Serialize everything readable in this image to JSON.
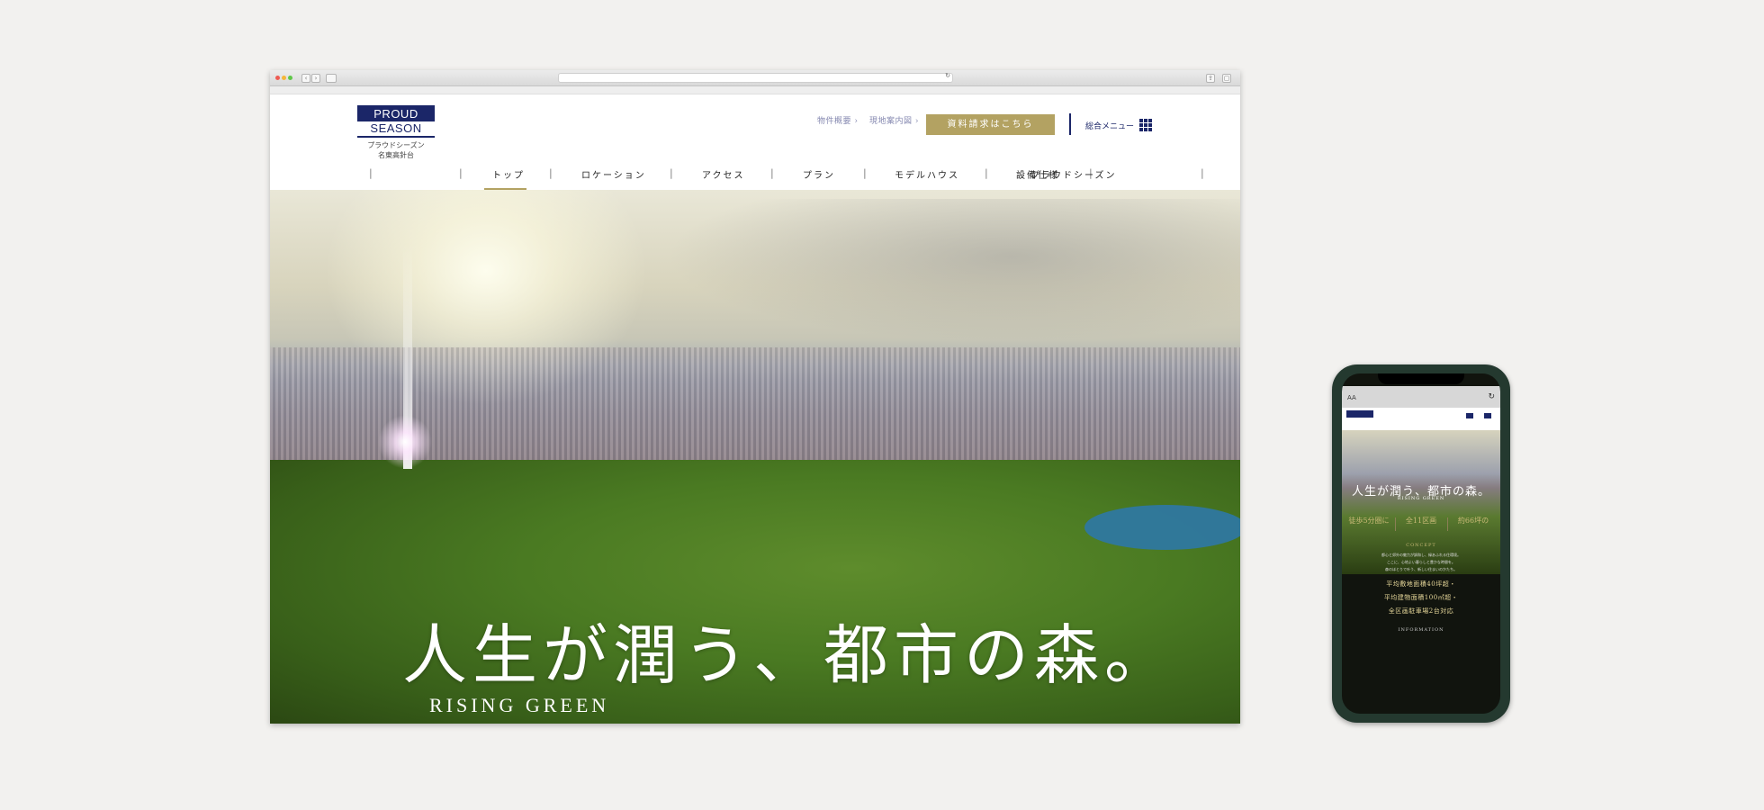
{
  "desktop": {
    "logo": {
      "line1": "PROUD",
      "line2": "SEASON",
      "jp1": "プラウドシーズン",
      "jp2": "名東高針台"
    },
    "util_links": [
      "物件概要 ›",
      "現地案内図 ›"
    ],
    "cta": "資料請求はこちら",
    "menu_label": "総合メニュー",
    "nav": [
      "トップ",
      "ロケーション",
      "アクセス",
      "プラン",
      "モデルハウス",
      "設備仕様",
      "プラウドシーズン"
    ],
    "active_nav": "トップ",
    "hero": {
      "headline": "人生が潤う、都市の森。",
      "subheadline": "RISING GREEN"
    },
    "colors": {
      "navy": "#1b2668",
      "gold": "#b3a262"
    }
  },
  "phone": {
    "aa": "AA",
    "reload": "↻",
    "headline": "人生が潤う、都市の森。",
    "subheadline": "RISING GREEN",
    "stats": [
      "徒歩5分圏に",
      "全11区画",
      "約66坪の"
    ],
    "concept_label": "CONCEPT",
    "concept_text": [
      "都心と郊外の魅力が調和し、緑あふれる住環境。",
      "ここに、心地よい暮らしと豊かな時間を。",
      "森のほとりで叶う、新しい住まいのかたち。"
    ],
    "features": [
      "平均敷地面積40坪超・",
      "平均建物面積100㎡超・",
      "全区画駐車場2台対応"
    ],
    "info_label": "INFORMATION"
  }
}
